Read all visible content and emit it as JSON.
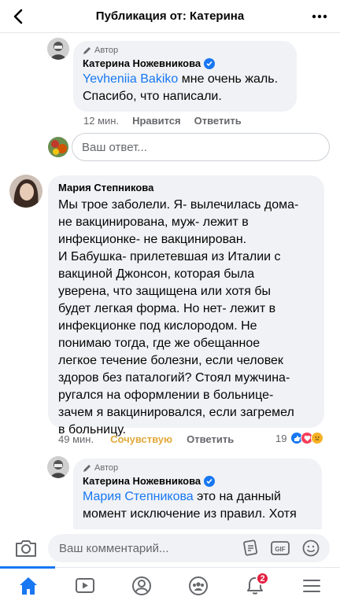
{
  "header": {
    "title": "Публикация от: Катерина",
    "back_icon": "chevron-left-icon",
    "more_icon": "more-dots-icon"
  },
  "reply1": {
    "badge": "Автор",
    "author": "Катерина Ножевникова",
    "mention": "Yevheniia Bakiko",
    "text_after_mention": " мне очень жаль. Спасибо, что написали.",
    "time": "12 мин.",
    "like": "Нравится",
    "reply": "Ответить"
  },
  "reply_input": {
    "placeholder": "Ваш ответ..."
  },
  "comment2": {
    "author": "Мария Степникова",
    "lines": [
      "Мы трое заболели. Я- вылечилась дома-",
      "не вакцинирована, муж- лежит в",
      "инфекционке- не вакцинирован.",
      "И Бабушка- прилетевшая из Италии с",
      "вакциной Джонсон, которая была",
      "уверена, что защищена или хотя бы",
      "будет легкая форма. Но нет- лежит в",
      "инфекционке под кислородом. Не",
      "понимаю тогда, где же обещанное",
      "легкое течение болезни, если человек",
      "здоров без паталогий? Стоял мужчина-",
      "ругался на оформлении в больнице-",
      "зачем я вакцинировался, если загремел",
      "в больницу."
    ],
    "time": "49 мин.",
    "sympathy": "Сочувствую",
    "reply": "Ответить",
    "reactions_count": "19"
  },
  "reply2": {
    "badge": "Автор",
    "author": "Катерина Ножевникова",
    "mention": "Мария Степникова",
    "line1_after": " это на данный",
    "line2": "момент исключение из правил. Хотя"
  },
  "composer": {
    "placeholder": "Ваш комментарий..."
  },
  "tabbar": {
    "notifications_badge": "2"
  },
  "colors": {
    "accent": "#1877f2",
    "bubble": "#f0f2f5",
    "sympathy": "#e2a93a",
    "badge": "#e41e3f"
  }
}
